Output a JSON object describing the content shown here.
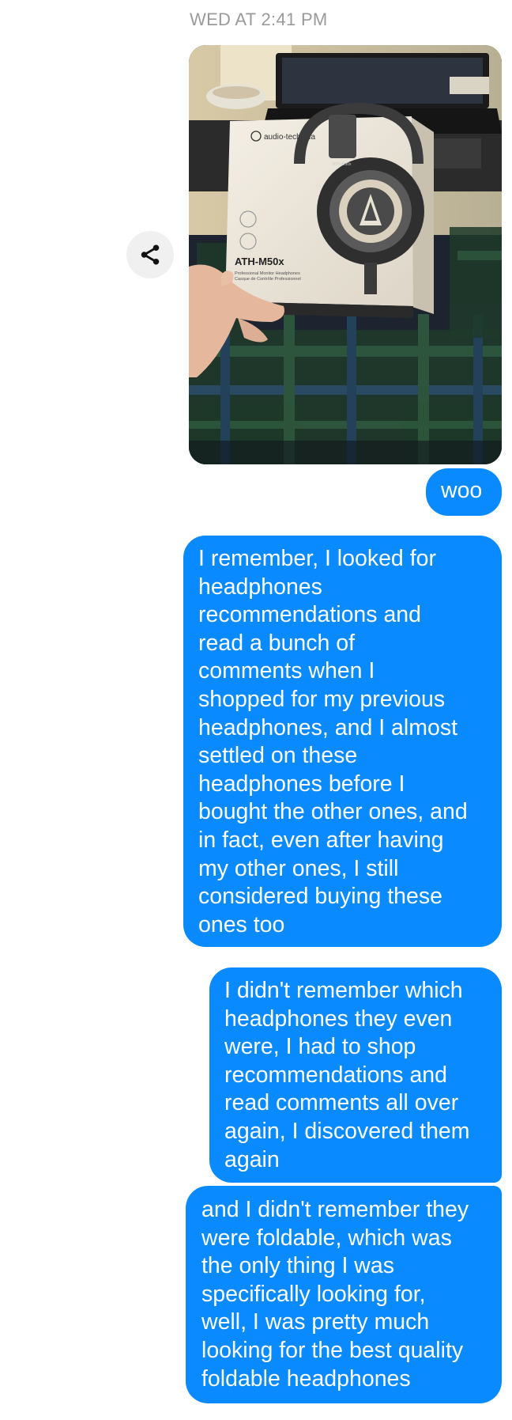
{
  "conversation": {
    "timestamp": "WED AT 2:41 PM"
  },
  "shared_photo": {
    "icon": "share-icon",
    "box_brand": "audio-technica",
    "box_model": "ATH-M50x",
    "box_model_caption": "ATH-M50x",
    "box_fine_print": [
      "Professional Monitor Headphones",
      "Casque de Contrôle Professionnel"
    ]
  },
  "messages": [
    {
      "from": "me",
      "lines": [
        "woo"
      ]
    },
    {
      "from": "me",
      "lines": [
        "I remember, I looked for",
        "headphones",
        "recommendations and",
        "read a bunch of",
        "comments when I",
        "shopped for my previous",
        "headphones, and I almost",
        "settled on these",
        "headphones before I",
        "bought the other ones, and",
        "in fact, even after having",
        "my other ones, I still",
        "considered buying these",
        "ones too"
      ]
    },
    {
      "from": "me",
      "lines": [
        "I didn't remember which",
        "headphones they even",
        "were, I had to shop",
        "recommendations and",
        "read comments all over",
        "again, I discovered them",
        "again"
      ]
    },
    {
      "from": "me",
      "lines": [
        "and I didn't remember they",
        "were foldable, which was",
        "the only thing I was",
        "specifically looking for,",
        "well, I was pretty much",
        "looking for the best quality",
        "foldable headphones"
      ]
    }
  ],
  "colors": {
    "bubble_sent": "#0a8aff",
    "bubble_text": "#ffffff",
    "timestamp_text": "#9a9a9a",
    "share_button_bg": "#f0f0f0"
  }
}
